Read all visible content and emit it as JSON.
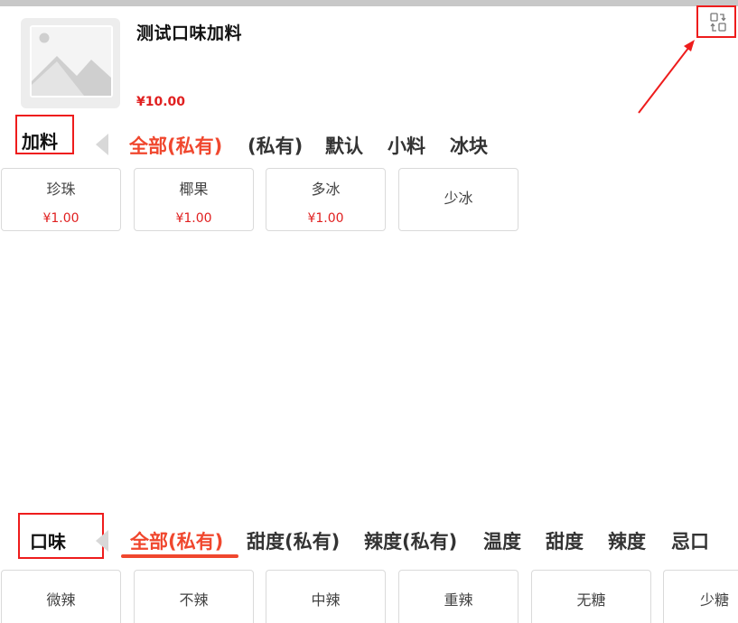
{
  "product": {
    "title": "测试口味加料",
    "price": "¥10.00",
    "image_icon": "image-placeholder-icon"
  },
  "switch_button": {
    "icon": "swap-icon"
  },
  "annotation_color": "#ee1c1c",
  "accent_color": "#f0472e",
  "price_color": "#e02020",
  "toppings": {
    "label": "加料",
    "tabs": [
      {
        "label": "全部(私有)",
        "active": true
      },
      {
        "label": "(私有)"
      },
      {
        "label": "默认"
      },
      {
        "label": "小料"
      },
      {
        "label": "冰块"
      }
    ],
    "options": [
      {
        "name": "珍珠",
        "price": "¥1.00"
      },
      {
        "name": "椰果",
        "price": "¥1.00"
      },
      {
        "name": "多冰",
        "price": "¥1.00"
      },
      {
        "name": "少冰"
      }
    ]
  },
  "flavor": {
    "label": "口味",
    "tabs": [
      {
        "label": "全部(私有)",
        "active": true
      },
      {
        "label": "甜度(私有)"
      },
      {
        "label": "辣度(私有)"
      },
      {
        "label": "温度"
      },
      {
        "label": "甜度"
      },
      {
        "label": "辣度"
      },
      {
        "label": "忌口"
      }
    ],
    "options": [
      {
        "name": "微辣"
      },
      {
        "name": "不辣"
      },
      {
        "name": "中辣"
      },
      {
        "name": "重辣"
      },
      {
        "name": "无糖"
      },
      {
        "name": "少糖"
      }
    ]
  }
}
